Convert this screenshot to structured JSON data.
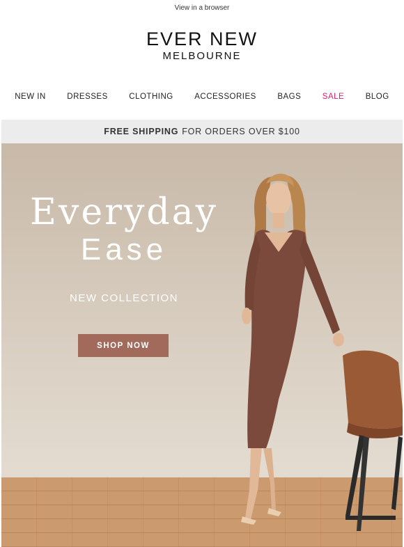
{
  "topbar": {
    "browser_link": "View in a browser"
  },
  "logo": {
    "brand": "EVER NEW",
    "city": "MELBOURNE"
  },
  "nav": [
    {
      "label": "NEW IN"
    },
    {
      "label": "DRESSES"
    },
    {
      "label": "CLOTHING"
    },
    {
      "label": "ACCESSORIES"
    },
    {
      "label": "BAGS"
    },
    {
      "label": "SALE",
      "color": "#d8206e"
    },
    {
      "label": "BLOG"
    }
  ],
  "shipping": {
    "bold": "FREE SHIPPING",
    "rest": "FOR ORDERS OVER $100"
  },
  "hero": {
    "line1": "Everyday",
    "line2": "Ease",
    "subtitle": "NEW COLLECTION",
    "cta": "SHOP NOW",
    "cta_color": "#a26a5a"
  }
}
